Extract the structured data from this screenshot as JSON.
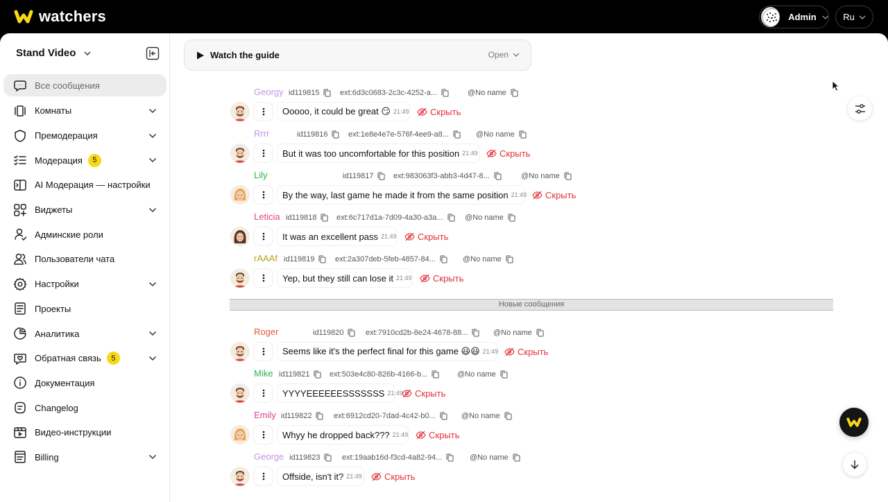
{
  "header": {
    "logo_text": "watchers",
    "user_label": "Admin",
    "language": "Ru",
    "brand_color": "#f7d917"
  },
  "sidebar": {
    "project": "Stand Video",
    "items": [
      {
        "label": "Все сообщения",
        "icon": "chat-icon",
        "active": true
      },
      {
        "label": "Комнаты",
        "icon": "rooms-icon",
        "chevron": true
      },
      {
        "label": "Премодерация",
        "icon": "shield-icon",
        "chevron": true
      },
      {
        "label": "Модерация",
        "icon": "list-check-icon",
        "badge": "5",
        "chevron": true
      },
      {
        "label": "AI Модерация — настройки",
        "icon": "ai-icon"
      },
      {
        "label": "Виджеты",
        "icon": "widgets-icon",
        "chevron": true
      },
      {
        "label": "Админские роли",
        "icon": "user-roles-icon"
      },
      {
        "label": "Пользователи чата",
        "icon": "users-icon"
      },
      {
        "label": "Настройки",
        "icon": "gear-icon",
        "chevron": true
      },
      {
        "label": "Проекты",
        "icon": "projects-icon"
      },
      {
        "label": "Аналитика",
        "icon": "pie-chart-icon",
        "chevron": true
      },
      {
        "label": "Обратная связь",
        "icon": "feedback-heart-icon",
        "badge": "5",
        "chevron": true
      },
      {
        "label": "Документация",
        "icon": "info-icon"
      },
      {
        "label": "Changelog",
        "icon": "changelog-icon"
      },
      {
        "label": "Видео-инструкции",
        "icon": "video-icon"
      },
      {
        "label": "Billing",
        "icon": "billing-icon",
        "chevron": true
      }
    ]
  },
  "guide": {
    "title": "Watch the guide",
    "open_label": "Open"
  },
  "divider_label": "Новые сообщения",
  "hide_label": "Скрыть",
  "messages": [
    {
      "name": "Georgy",
      "name_color": "#c792e8",
      "id": "id119815",
      "ext": "ext:6d3c0683-2c3c-4252-a...",
      "handle": "@No name",
      "text": "Ooooo, it could be great 😏",
      "time": "21:49",
      "avatar": "man-beard"
    },
    {
      "name": "Rrrr",
      "name_color": "#c792e8",
      "id": "id119816",
      "ext": "ext:1e8e4e7e-576f-4ee9-a8...",
      "handle": "@No name",
      "text": "But it was too uncomfortable for this position",
      "time": "21:49",
      "avatar": "man-beard"
    },
    {
      "name": "Lily",
      "name_color": "#2bb34a",
      "id": "id119817",
      "ext": "ext:983063f3-abb3-4d47-8...",
      "handle": "@No name",
      "text": "By the way, last game he made it from the same position",
      "time": "21:49",
      "avatar": "woman-blonde"
    },
    {
      "name": "Leticia",
      "name_color": "#e0457a",
      "id": "id119818",
      "ext": "ext:6c717d1a-7d09-4a30-a3a...",
      "handle": "@No name",
      "text": "It was an excellent pass",
      "time": "21:49",
      "avatar": "woman-dark"
    },
    {
      "name": "rAAAf",
      "name_color": "#b5a31a",
      "id": "id119819",
      "ext": "ext:2a307deb-5feb-4857-84...",
      "handle": "@No name",
      "text": "Yep, but they still can lose it",
      "time": "21:49",
      "avatar": "man-beard"
    },
    {
      "name": "Roger",
      "name_color": "#e2553a",
      "id": "id119820",
      "ext": "ext:7910cd2b-8e24-4678-88...",
      "handle": "@No name",
      "text": "Seems like it's the perfect final for this game 😃😃",
      "time": "21:49",
      "avatar": "man-beard"
    },
    {
      "name": "Mike",
      "name_color": "#2bb34a",
      "id": "id119821",
      "ext": "ext:503e4c80-826b-4166-b...",
      "handle": "@No name",
      "text": "YYYYEEEEEESSSSSSS",
      "time": "21:49",
      "avatar": "man-beard"
    },
    {
      "name": "Emily",
      "name_color": "#d9458f",
      "id": "id119822",
      "ext": "ext:6912cd20-7dad-4c42-b0...",
      "handle": "@No name",
      "text": "Whyy he dropped back???",
      "time": "21:49",
      "avatar": "woman-blonde"
    },
    {
      "name": "George",
      "name_color": "#c792e8",
      "id": "id119823",
      "ext": "ext:19aab16d-f3cd-4a82-94...",
      "handle": "@No name",
      "text": "Offside, isn't it?",
      "time": "21:49",
      "avatar": "man-beard"
    }
  ]
}
